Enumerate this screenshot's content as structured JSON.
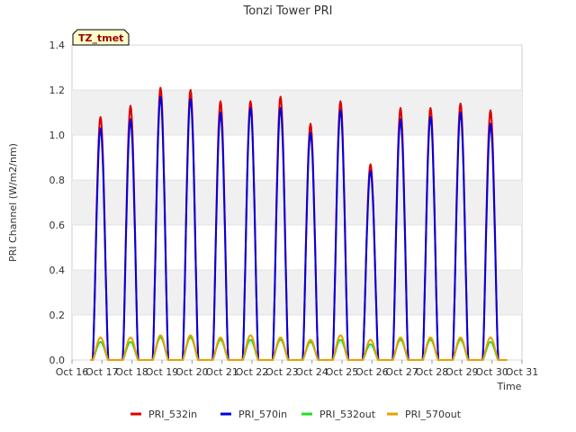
{
  "chart_data": {
    "type": "line",
    "title": "Tonzi Tower PRI",
    "xlabel": "Time",
    "ylabel": "PRI Channel (W/m2/nm)",
    "site_badge": "TZ_tmet",
    "ylim": [
      0,
      1.4
    ],
    "yticks": [
      "0.0",
      "0.2",
      "0.4",
      "0.6",
      "0.8",
      "1.0",
      "1.2",
      "1.4"
    ],
    "xlim": [
      16,
      31
    ],
    "xticks": [
      "Oct 16",
      "Oct 17",
      "Oct 18",
      "Oct 19",
      "Oct 20",
      "Oct 21",
      "Oct 22",
      "Oct 23",
      "Oct 24",
      "Oct 25",
      "Oct 26",
      "Oct 27",
      "Oct 28",
      "Oct 29",
      "Oct 30",
      "Oct 31"
    ],
    "grid": "horizontal bands",
    "legend_position": "bottom",
    "colors": {
      "PRI_532in": "#dd0000",
      "PRI_570in": "#0000dd",
      "PRI_532out": "#22dd22",
      "PRI_570out": "#e8a000"
    },
    "series": [
      {
        "name": "PRI_532in",
        "daily_peak_day": [
          16.95,
          17.95,
          18.95,
          19.95,
          20.95,
          21.95,
          22.95,
          23.95,
          24.95,
          25.95,
          26.95,
          27.95,
          28.95,
          29.95
        ],
        "daily_peak_values": [
          1.08,
          1.13,
          1.21,
          1.2,
          1.15,
          1.15,
          1.17,
          1.05,
          1.15,
          0.87,
          1.12,
          1.12,
          1.14,
          1.11
        ]
      },
      {
        "name": "PRI_570in",
        "daily_peak_day": [
          16.95,
          17.95,
          18.95,
          19.95,
          20.95,
          21.95,
          22.95,
          23.95,
          24.95,
          25.95,
          26.95,
          27.95,
          28.95,
          29.95
        ],
        "daily_peak_values": [
          1.03,
          1.07,
          1.17,
          1.16,
          1.1,
          1.12,
          1.12,
          1.01,
          1.11,
          0.84,
          1.07,
          1.08,
          1.1,
          1.05
        ]
      },
      {
        "name": "PRI_532out",
        "daily_peak_day": [
          16.95,
          17.95,
          18.95,
          19.95,
          20.95,
          21.95,
          22.95,
          23.95,
          24.95,
          25.95,
          26.95,
          27.95,
          28.95,
          29.95
        ],
        "daily_peak_values": [
          0.08,
          0.08,
          0.1,
          0.1,
          0.09,
          0.09,
          0.09,
          0.08,
          0.09,
          0.07,
          0.09,
          0.09,
          0.09,
          0.08
        ]
      },
      {
        "name": "PRI_570out",
        "daily_peak_day": [
          16.95,
          17.95,
          18.95,
          19.95,
          20.95,
          21.95,
          22.95,
          23.95,
          24.95,
          25.95,
          26.95,
          27.95,
          28.95,
          29.95
        ],
        "daily_peak_values": [
          0.1,
          0.1,
          0.11,
          0.11,
          0.1,
          0.11,
          0.1,
          0.09,
          0.11,
          0.09,
          0.1,
          0.1,
          0.1,
          0.1
        ]
      }
    ]
  }
}
